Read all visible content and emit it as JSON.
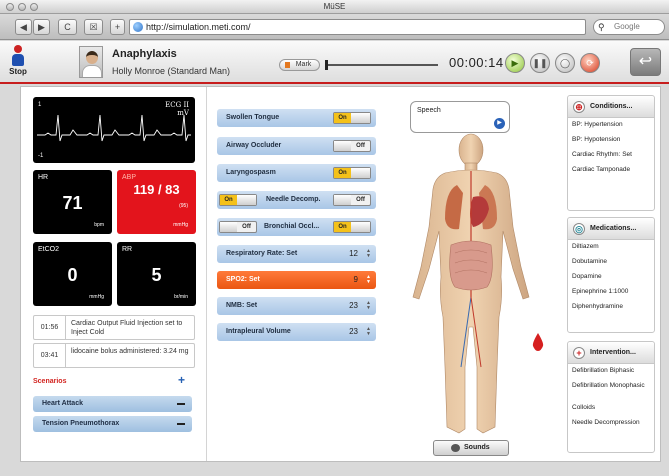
{
  "window": {
    "title": "MüSE"
  },
  "toolbar": {
    "back": "◀",
    "forward": "▶",
    "reload": "C",
    "add": "+",
    "url": "http://simulation.meti.com/",
    "search_placeholder": "Google"
  },
  "header": {
    "stop_label": "Stop",
    "scenario": "Anaphylaxis",
    "patient": "Holly Monroe  (Standard Man)",
    "mark_label": "Mark",
    "timer": "00:00:14",
    "back_icon": "↩"
  },
  "ecg": {
    "lead_num": "1",
    "lead_label": "ECG II",
    "unit": "mV",
    "min_label": "-1"
  },
  "vitals": {
    "hr": {
      "label": "HR",
      "value": "71",
      "unit": "bpm"
    },
    "abp": {
      "label": "ABP",
      "value": "119 / 83",
      "sub": "(95)",
      "unit": "mmHg"
    },
    "etco2": {
      "label": "EtCO2",
      "value": "0",
      "unit": "mmHg"
    },
    "rr": {
      "label": "RR",
      "value": "5",
      "unit": "br/min"
    }
  },
  "log": [
    {
      "time": "01:56",
      "msg": "Cardiac Output Fluid Injection set to Inject Cold"
    },
    {
      "time": "03:41",
      "msg": "lidocaine bolus administered: 3.24 mg"
    }
  ],
  "scenarios": {
    "heading": "Scenarios",
    "add": "+",
    "items": [
      "Heart Attack",
      "Tension Pneumothorax"
    ]
  },
  "controls": {
    "swollen_tongue": {
      "label": "Swollen Tongue",
      "state": "On"
    },
    "airway_occluder": {
      "label": "Airway Occluder",
      "state": "Off"
    },
    "laryngospasm": {
      "label": "Laryngospasm",
      "state": "On"
    },
    "needle_decomp": {
      "label": "Needle Decomp.",
      "left": "On",
      "right": "Off"
    },
    "bronchial": {
      "label": "Bronchial Occl...",
      "left": "Off",
      "right": "On"
    },
    "respiratory_rate": {
      "label": "Respiratory Rate: Set",
      "value": "12"
    },
    "spo2": {
      "label": "SPO2: Set",
      "value": "9"
    },
    "nmb": {
      "label": "NMB: Set",
      "value": "23"
    },
    "intrapleural": {
      "label": "Intrapleural Volume",
      "value": "23"
    }
  },
  "speech": {
    "label": "Speech"
  },
  "sounds": {
    "label": "Sounds"
  },
  "conditions": {
    "title": "Conditions...",
    "items": [
      "BP: Hypertension",
      "BP: Hypotension",
      "Cardiac Rhythm: Set",
      "Cardiac Tamponade"
    ]
  },
  "medications": {
    "title": "Medications...",
    "items": [
      "Diltiazem",
      "Dobutamine",
      "Dopamine",
      "Epinephrine 1:1000",
      "Diphenhydramine"
    ]
  },
  "interventions": {
    "title": "Intervention...",
    "items": [
      "Defibrillation Biphasic",
      "Defibrillation Monophasic",
      "Colloids",
      "Needle Decompression"
    ]
  },
  "colors": {
    "alarm_red": "#e3141c",
    "accent_orange": "#ea5612",
    "toggle_on": "#f4c11a",
    "scenario_red": "#d2231f"
  }
}
